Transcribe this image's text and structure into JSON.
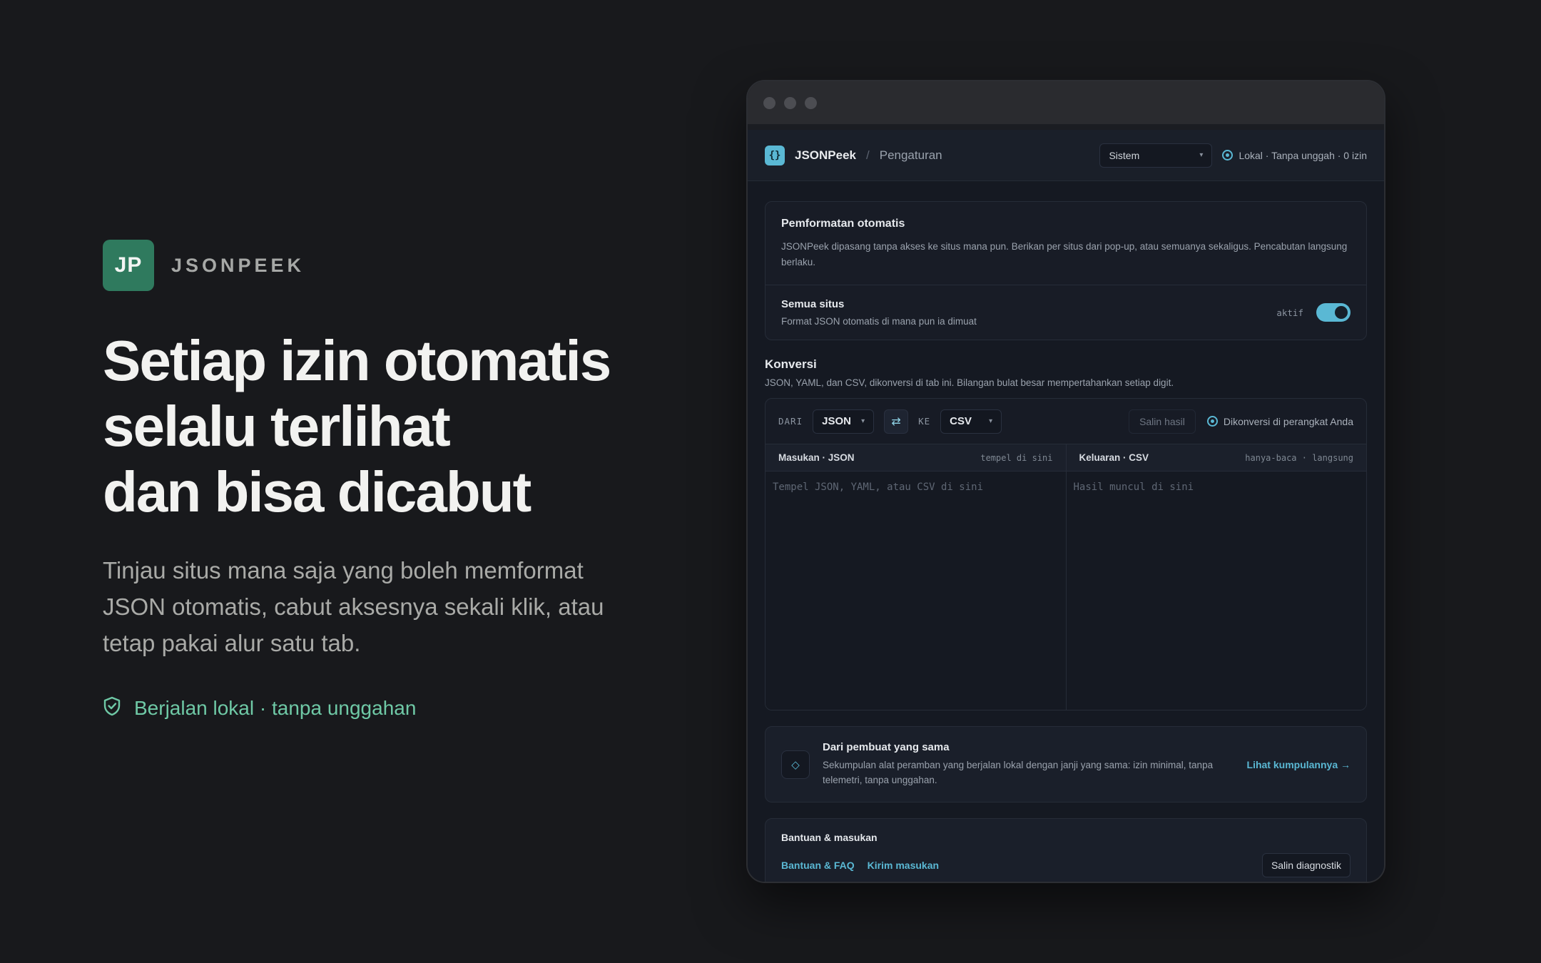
{
  "hero": {
    "logo_initials": "JP",
    "brand_name": "JSONPEEK",
    "headline_lines": [
      "Setiap izin otomatis",
      "selalu terlihat",
      "dan bisa dicabut"
    ],
    "lede": "Tinjau situs mana saja yang boleh memformat JSON otomatis, cabut aksesnya sekali klik, atau tetap pakai alur satu tab.",
    "trust": "Berjalan lokal · tanpa unggahan"
  },
  "app": {
    "icon_glyph": "{}",
    "name": "JSONPeek",
    "breadcrumb_sep": "/",
    "breadcrumb": "Pengaturan",
    "theme_select": "Sistem",
    "status": "Lokal · Tanpa unggah · 0 izin"
  },
  "auto_format": {
    "title": "Pemformatan otomatis",
    "desc": "JSONPeek dipasang tanpa akses ke situs mana pun. Berikan per situs dari pop-up, atau semuanya sekaligus. Pencabutan langsung berlaku.",
    "all_sites_title": "Semua situs",
    "all_sites_desc": "Format JSON otomatis di mana pun ia dimuat",
    "toggle_state_label": "aktif",
    "toggle_on": true
  },
  "conversion": {
    "title": "Konversi",
    "desc": "JSON, YAML, dan CSV, dikonversi di tab ini. Bilangan bulat besar mempertahankan setiap digit.",
    "from_label": "DARI",
    "from_value": "JSON",
    "to_label": "KE",
    "to_value": "CSV",
    "swap_glyph": "⇄",
    "copy_result": "Salin hasil",
    "status": "Dikonversi di perangkat Anda",
    "input_title": "Masukan · JSON",
    "input_hint": "tempel di sini",
    "input_placeholder": "Tempel JSON, YAML, atau CSV di sini",
    "output_title": "Keluaran · CSV",
    "output_hint": "hanya-baca · langsung",
    "output_placeholder": "Hasil muncul di sini"
  },
  "promo": {
    "icon_glyph": "◇",
    "title": "Dari pembuat yang sama",
    "desc": "Sekumpulan alat peramban yang berjalan lokal dengan janji yang sama: izin minimal, tanpa telemetri, tanpa unggahan.",
    "link": "Lihat kumpulannya →"
  },
  "help": {
    "title": "Bantuan & masukan",
    "faq_link": "Bantuan & FAQ",
    "feedback_link": "Kirim masukan",
    "diagnostics_button": "Salin diagnostik"
  },
  "colors": {
    "accent": "#5ab8d4",
    "brand_green": "#2f7a5e",
    "trust_green": "#6fc9a6",
    "background": "#18191c"
  }
}
